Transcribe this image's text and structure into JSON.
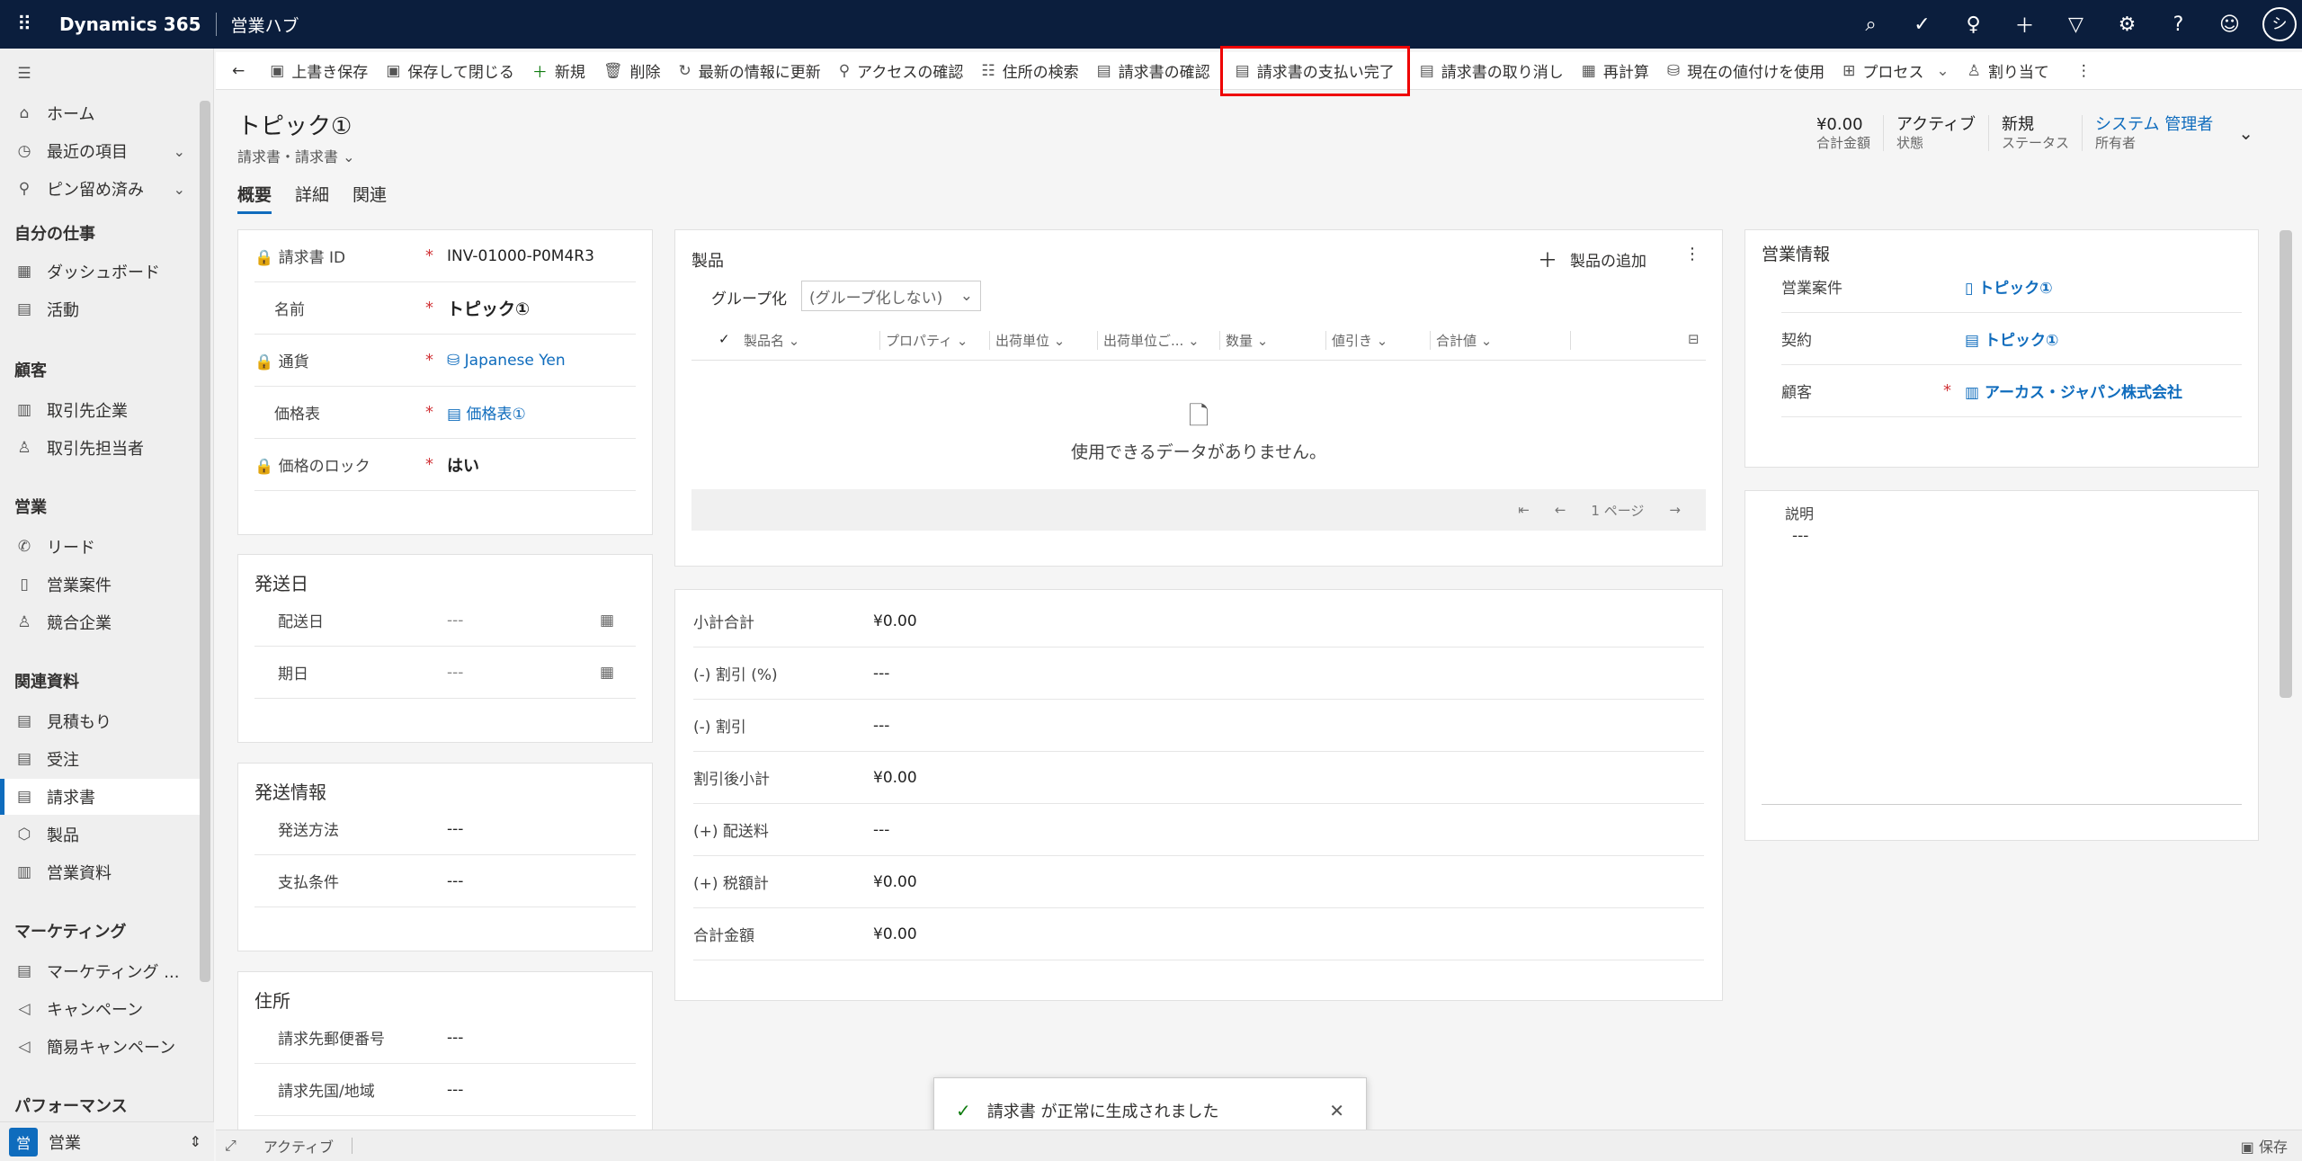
{
  "topbar": {
    "app_name": "Dynamics 365",
    "hub": "営業ハブ",
    "avatar": "シ"
  },
  "sidebar": {
    "home": "ホーム",
    "recent": "最近の項目",
    "pinned": "ピン留め済み",
    "g_mywork": "自分の仕事",
    "dashboard": "ダッシュボード",
    "activities": "活動",
    "g_customers": "顧客",
    "accounts": "取引先企業",
    "contacts": "取引先担当者",
    "g_sales": "営業",
    "leads": "リード",
    "opportunities": "営業案件",
    "competitors": "競合企業",
    "g_collateral": "関連資料",
    "quotes": "見積もり",
    "orders": "受注",
    "invoices": "請求書",
    "products": "製品",
    "literature": "営業資料",
    "g_marketing": "マーケティング",
    "marketing_lists": "マーケティング ...",
    "campaigns": "キャンペーン",
    "quick_campaigns": "簡易キャンペーン",
    "g_performance": "パフォーマンス",
    "area": "営業",
    "area_badge": "営"
  },
  "commands": [
    "上書き保存",
    "保存して閉じる",
    "新規",
    "削除",
    "最新の情報に更新",
    "アクセスの確認",
    "住所の検索",
    "請求書の確認",
    "請求書の支払い完了",
    "請求書の取り消し",
    "再計算",
    "現在の値付けを使用",
    "プロセス",
    "割り当て"
  ],
  "header": {
    "title": "トピック①",
    "subtitle": "請求書・請求書",
    "amount": "¥0.00",
    "amount_label": "合計金額",
    "state": "アクティブ",
    "state_label": "状態",
    "status": "新規",
    "status_label": "ステータス",
    "owner": "システム 管理者",
    "owner_label": "所有者"
  },
  "tabs": [
    "概要",
    "詳細",
    "関連"
  ],
  "general": {
    "id_label": "請求書 ID",
    "id": "INV-01000-P0M4R3",
    "name_label": "名前",
    "name": "トピック①",
    "currency_label": "通貨",
    "currency": "Japanese Yen",
    "pricelist_label": "価格表",
    "pricelist": "価格表①",
    "lock_label": "価格のロック",
    "lock": "はい",
    "req": "*"
  },
  "shipping_date": {
    "title": "発送日",
    "delivery_label": "配送日",
    "delivery": "---",
    "due_label": "期日",
    "due": "---"
  },
  "shipping_info": {
    "title": "発送情報",
    "method_label": "発送方法",
    "method": "---",
    "terms_label": "支払条件",
    "terms": "---"
  },
  "address": {
    "title": "住所",
    "zip_label": "請求先郵便番号",
    "zip": "---",
    "country_label": "請求先国/地域",
    "country": "---"
  },
  "products": {
    "title": "製品",
    "add": "製品の追加",
    "groupby_label": "グループ化",
    "groupby": "(グループ化しない)",
    "columns": [
      "製品名",
      "プロパティ",
      "出荷単位",
      "出荷単位ご...",
      "数量",
      "値引き",
      "合計値"
    ],
    "empty": "使用できるデータがありません。",
    "page": "1 ページ"
  },
  "totals": [
    {
      "l": "小計合計",
      "v": "¥0.00"
    },
    {
      "l": "(-) 割引 (%)",
      "v": "---"
    },
    {
      "l": "(-) 割引",
      "v": "---"
    },
    {
      "l": "割引後小計",
      "v": "¥0.00"
    },
    {
      "l": "(+) 配送料",
      "v": "---"
    },
    {
      "l": "(+) 税額計",
      "v": "¥0.00"
    },
    {
      "l": "合計金額",
      "v": "¥0.00"
    }
  ],
  "sales_info": {
    "title": "営業情報",
    "opp_label": "営業案件",
    "opp": "トピック①",
    "contract_label": "契約",
    "contract": "トピック①",
    "customer_label": "顧客",
    "customer": "アーカス・ジャパン株式会社",
    "req": "*"
  },
  "description": {
    "label": "説明",
    "value": "---"
  },
  "toast": {
    "message": "請求書 が正常に生成されました"
  },
  "status": {
    "state": "アクティブ",
    "save": "保存"
  }
}
